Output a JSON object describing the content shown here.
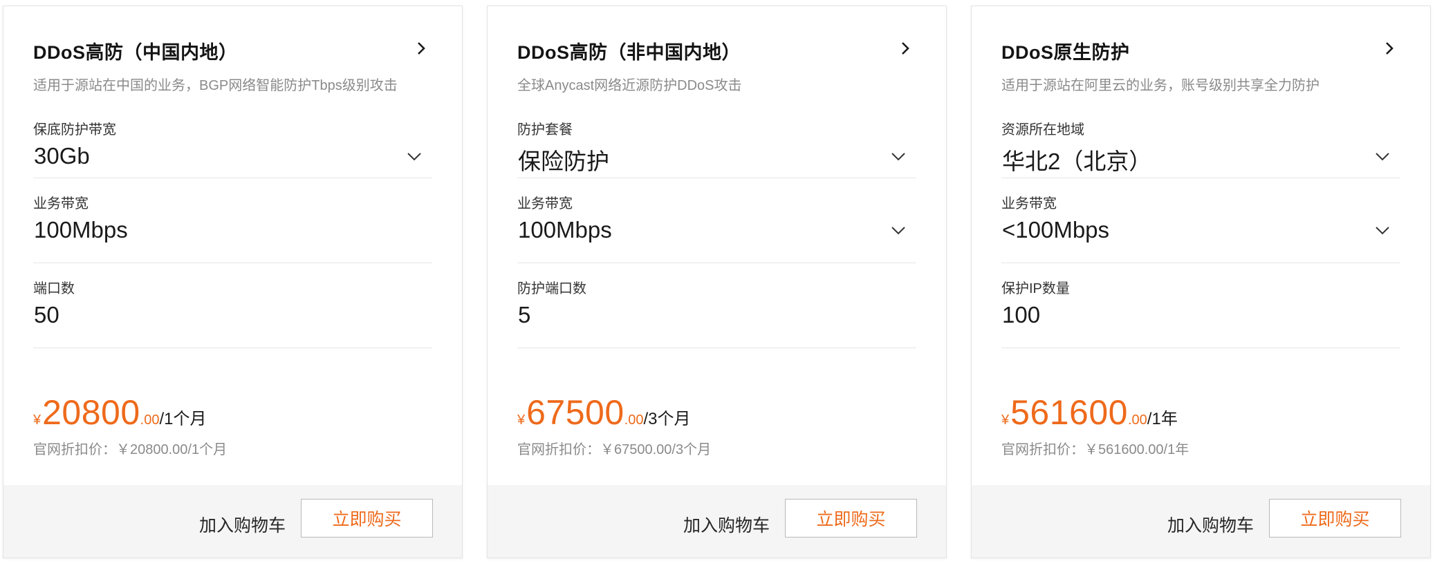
{
  "accent_color": "#ee6a1b",
  "cards": [
    {
      "title": "DDoS高防（中国内地）",
      "subtitle": "适用于源站在中国的业务，BGP网络智能防护Tbps级别攻击",
      "fields": [
        {
          "label": "保底防护带宽",
          "value": "30Gb",
          "has_dropdown": true
        },
        {
          "label": "业务带宽",
          "value": "100Mbps",
          "has_dropdown": false
        },
        {
          "label": "端口数",
          "value": "50",
          "has_dropdown": false
        }
      ],
      "price": {
        "currency": "¥",
        "amount": "20800",
        "decimal": ".00",
        "period": "/1个月",
        "official": "官网折扣价：￥20800.00/1个月"
      },
      "add_cart_label": "加入购物车",
      "buy_now_label": "立即购买"
    },
    {
      "title": "DDoS高防（非中国内地）",
      "subtitle": "全球Anycast网络近源防护DDoS攻击",
      "fields": [
        {
          "label": "防护套餐",
          "value": "保险防护",
          "has_dropdown": true
        },
        {
          "label": "业务带宽",
          "value": "100Mbps",
          "has_dropdown": true
        },
        {
          "label": "防护端口数",
          "value": "5",
          "has_dropdown": false
        }
      ],
      "price": {
        "currency": "¥",
        "amount": "67500",
        "decimal": ".00",
        "period": "/3个月",
        "official": "官网折扣价：￥67500.00/3个月"
      },
      "add_cart_label": "加入购物车",
      "buy_now_label": "立即购买"
    },
    {
      "title": "DDoS原生防护",
      "subtitle": "适用于源站在阿里云的业务，账号级别共享全力防护",
      "fields": [
        {
          "label": "资源所在地域",
          "value": "华北2（北京）",
          "has_dropdown": true
        },
        {
          "label": "业务带宽",
          "value": "<100Mbps",
          "has_dropdown": true
        },
        {
          "label": "保护IP数量",
          "value": "100",
          "has_dropdown": false
        }
      ],
      "price": {
        "currency": "¥",
        "amount": "561600",
        "decimal": ".00",
        "period": "/1年",
        "official": "官网折扣价：￥561600.00/1年"
      },
      "add_cart_label": "加入购物车",
      "buy_now_label": "立即购买"
    }
  ]
}
